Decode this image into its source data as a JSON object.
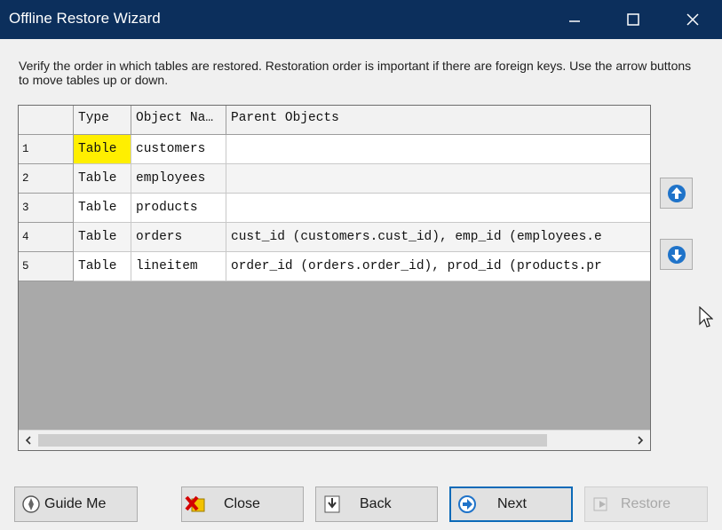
{
  "window": {
    "title": "Offline Restore Wizard"
  },
  "instructions": "Verify the order in which tables are restored. Restoration order is important if there are foreign keys. Use the arrow buttons to move tables up or down.",
  "grid": {
    "columns": [
      "",
      "Type",
      "Object Na…",
      "Parent Objects"
    ],
    "rows": [
      {
        "num": "1",
        "type": "Table",
        "name": "customers",
        "parents": ""
      },
      {
        "num": "2",
        "type": "Table",
        "name": "employees",
        "parents": ""
      },
      {
        "num": "3",
        "type": "Table",
        "name": "products",
        "parents": ""
      },
      {
        "num": "4",
        "type": "Table",
        "name": "orders",
        "parents": "cust_id (customers.cust_id), emp_id (employees.e"
      },
      {
        "num": "5",
        "type": "Table",
        "name": "lineitem",
        "parents": "order_id (orders.order_id), prod_id (products.pr"
      }
    ]
  },
  "move_buttons": {
    "up_icon": "arrow-up-icon",
    "down_icon": "arrow-down-icon"
  },
  "buttons": {
    "guide": "Guide Me",
    "close": "Close",
    "back": "Back",
    "next": "Next",
    "restore": "Restore"
  },
  "colors": {
    "titlebar": "#0c2f5c",
    "selection": "#ffef00",
    "accent": "#0b6ab8"
  }
}
